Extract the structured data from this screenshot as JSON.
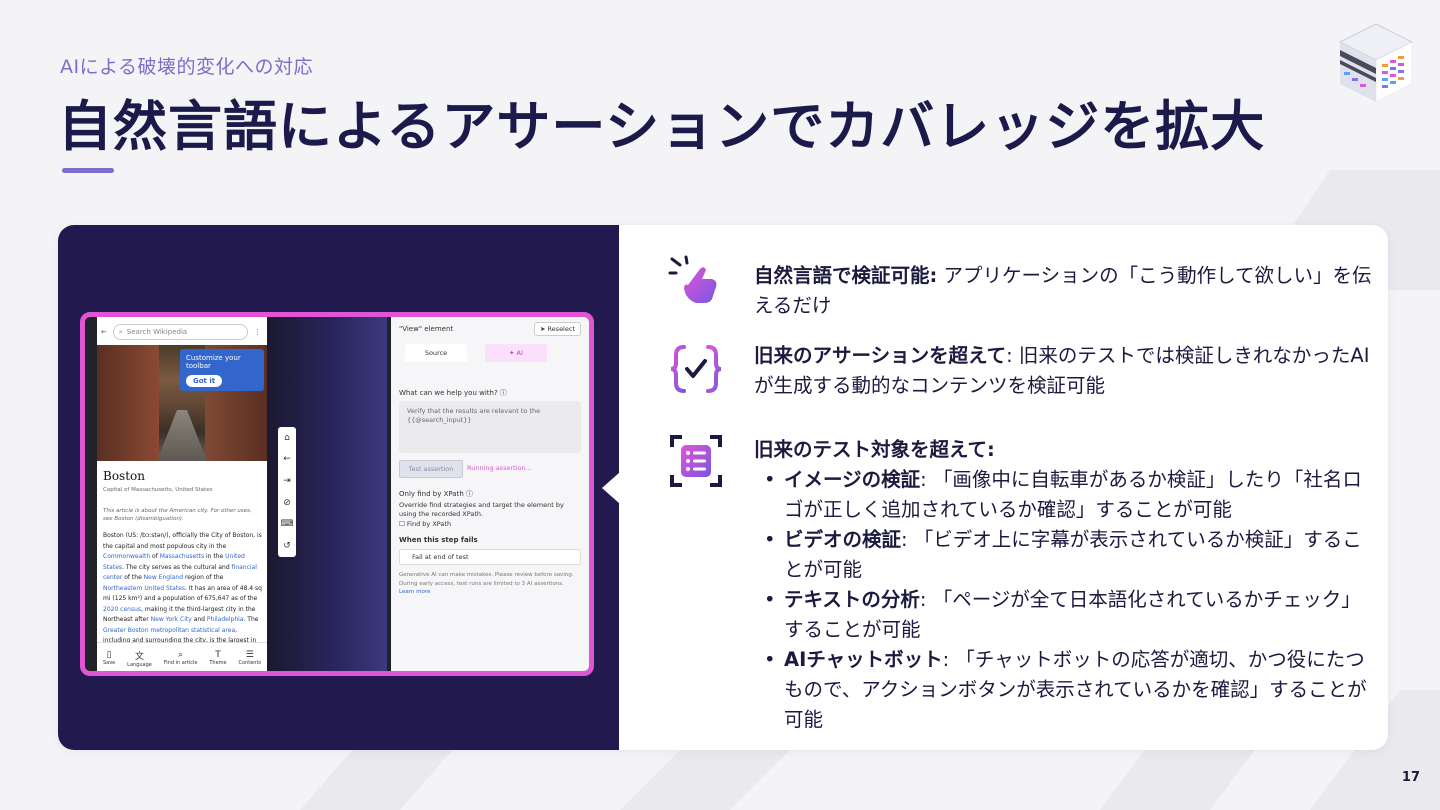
{
  "slide": {
    "subtitle": "AIによる破壊的変化への対応",
    "title": "自然言語によるアサーションでカバレッジを拡大",
    "page_number": "17"
  },
  "screenshot": {
    "phone": {
      "search_placeholder": "Search Wikipedia",
      "tooltip_text": "Customize your toolbar",
      "tooltip_button": "Got it",
      "article_title": "Boston",
      "article_caption": "Capital of Massachusetts, United States",
      "article_note": "This article is about the American city. For other uses, see Boston (disambiguation).",
      "body_html_parts": [
        "Boston (US: /bɔːstən/), officially the City of Boston, is the capital and most populous city in the ",
        "Commonwealth",
        " of ",
        "Massachusetts",
        " in the ",
        "United States",
        ". The city serves as the cultural and ",
        "financial center",
        " of the ",
        "New England",
        " region of the ",
        "Northeastern United States",
        ". It has an area of 48.4 sq mi (125 km²) and a population of 675,647 as of the ",
        "2020 census",
        ", making it the third-largest city in the Northeast after ",
        "New York City",
        " and ",
        "Philadelphia",
        ". The ",
        "Greater Boston metropolitan statistical area",
        ", including and surrounding the city, is the largest in New England and eleventh-largest in the"
      ],
      "nav": [
        {
          "icon": "bookmark-icon",
          "label": "Save"
        },
        {
          "icon": "translate-icon",
          "label": "Language"
        },
        {
          "icon": "find-icon",
          "label": "Find in article"
        },
        {
          "icon": "theme-icon",
          "label": "Theme"
        },
        {
          "icon": "contents-icon",
          "label": "Contents"
        }
      ]
    },
    "panel": {
      "element_label": "\"View\" element",
      "reselect_button": "Reselect",
      "tab_source": "Source",
      "tab_ai": "✦ AI",
      "question": "What can we help you with? ⓘ",
      "textarea": "Verify that the results are relevant to the {{@search_input}}",
      "test_button": "Test assertion",
      "running": "Running assertion...",
      "xpath_title": "Only find by XPath ⓘ",
      "xpath_desc": "Override find strategies and target the element by using the recorded XPath.",
      "xpath_checkbox": "Find by XPath",
      "fail_label": "When this step fails",
      "fail_select": "Fail at end of test",
      "disclaimer": "Generative AI can make mistakes. Please review before saving. During early access, test runs are limited to 3 AI assertions.",
      "learn_more": "Learn more"
    }
  },
  "features": [
    {
      "icon": "tap-gesture-icon",
      "bold": "自然言語で検証可能:",
      "text": " アプリケーションの「こう動作して欲しい」を伝えるだけ"
    },
    {
      "icon": "code-check-icon",
      "bold": "旧来のアサーションを超えて",
      "text": ": 旧来のテストでは検証しきれなかったAIが生成する動的なコンテンツを検証可能"
    },
    {
      "icon": "scan-list-icon",
      "bold": "旧来のテスト対象を超えて:",
      "text": "",
      "bullets": [
        {
          "bold": "イメージの検証",
          "text": ": 「画像中に自転車があるか検証」したり「社名ロゴが正しく追加されているか確認」することが可能"
        },
        {
          "bold": "ビデオの検証",
          "text": ": 「ビデオ上に字幕が表示されているか検証」することが可能"
        },
        {
          "bold": "テキストの分析",
          "text": ": 「ページが全て日本語化されているかチェック」することが可能"
        },
        {
          "bold": "AIチャットボット",
          "text": ": 「チャットボットの応答が適切、かつ役にたつもので、アクションボタンが表示されているかを確認」することが可能"
        }
      ]
    }
  ],
  "colors": {
    "accent_purple": "#7a6fc9",
    "dark_panel": "#221a4e",
    "highlight_pink": "#e055d6",
    "title": "#1c1a4a"
  }
}
